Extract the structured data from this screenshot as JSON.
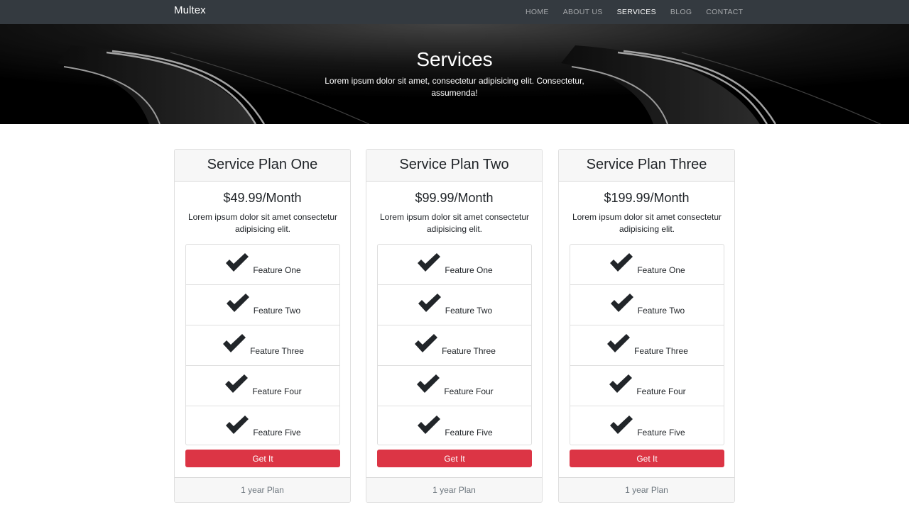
{
  "navbar": {
    "brand": "Multex",
    "links": [
      {
        "label": "HOME",
        "active": false
      },
      {
        "label": "ABOUT US",
        "active": false
      },
      {
        "label": "SERVICES",
        "active": true
      },
      {
        "label": "BLOG",
        "active": false
      },
      {
        "label": "CONTACT",
        "active": false
      }
    ]
  },
  "hero": {
    "title": "Services",
    "text": "Lorem ipsum dolor sit amet, consectetur adipisicing elit. Consectetur, assumenda!"
  },
  "plans": [
    {
      "title": "Service Plan One",
      "price": "$49.99/Month",
      "description": "Lorem ipsum dolor sit amet consectetur adipisicing elit.",
      "features": [
        "Feature One",
        "Feature Two",
        "Feature Three",
        "Feature Four",
        "Feature Five"
      ],
      "button": "Get It",
      "footer": "1 year Plan"
    },
    {
      "title": "Service Plan Two",
      "price": "$99.99/Month",
      "description": "Lorem ipsum dolor sit amet consectetur adipisicing elit.",
      "features": [
        "Feature One",
        "Feature Two",
        "Feature Three",
        "Feature Four",
        "Feature Five"
      ],
      "button": "Get It",
      "footer": "1 year Plan"
    },
    {
      "title": "Service Plan Three",
      "price": "$199.99/Month",
      "description": "Lorem ipsum dolor sit amet consectetur adipisicing elit.",
      "features": [
        "Feature One",
        "Feature Two",
        "Feature Three",
        "Feature Four",
        "Feature Five"
      ],
      "button": "Get It",
      "footer": "1 year Plan"
    }
  ],
  "icons": {
    "feature": "check-icon"
  },
  "colors": {
    "navbar": "#343a40",
    "button": "#dc3545",
    "card_header": "#f7f7f7"
  }
}
